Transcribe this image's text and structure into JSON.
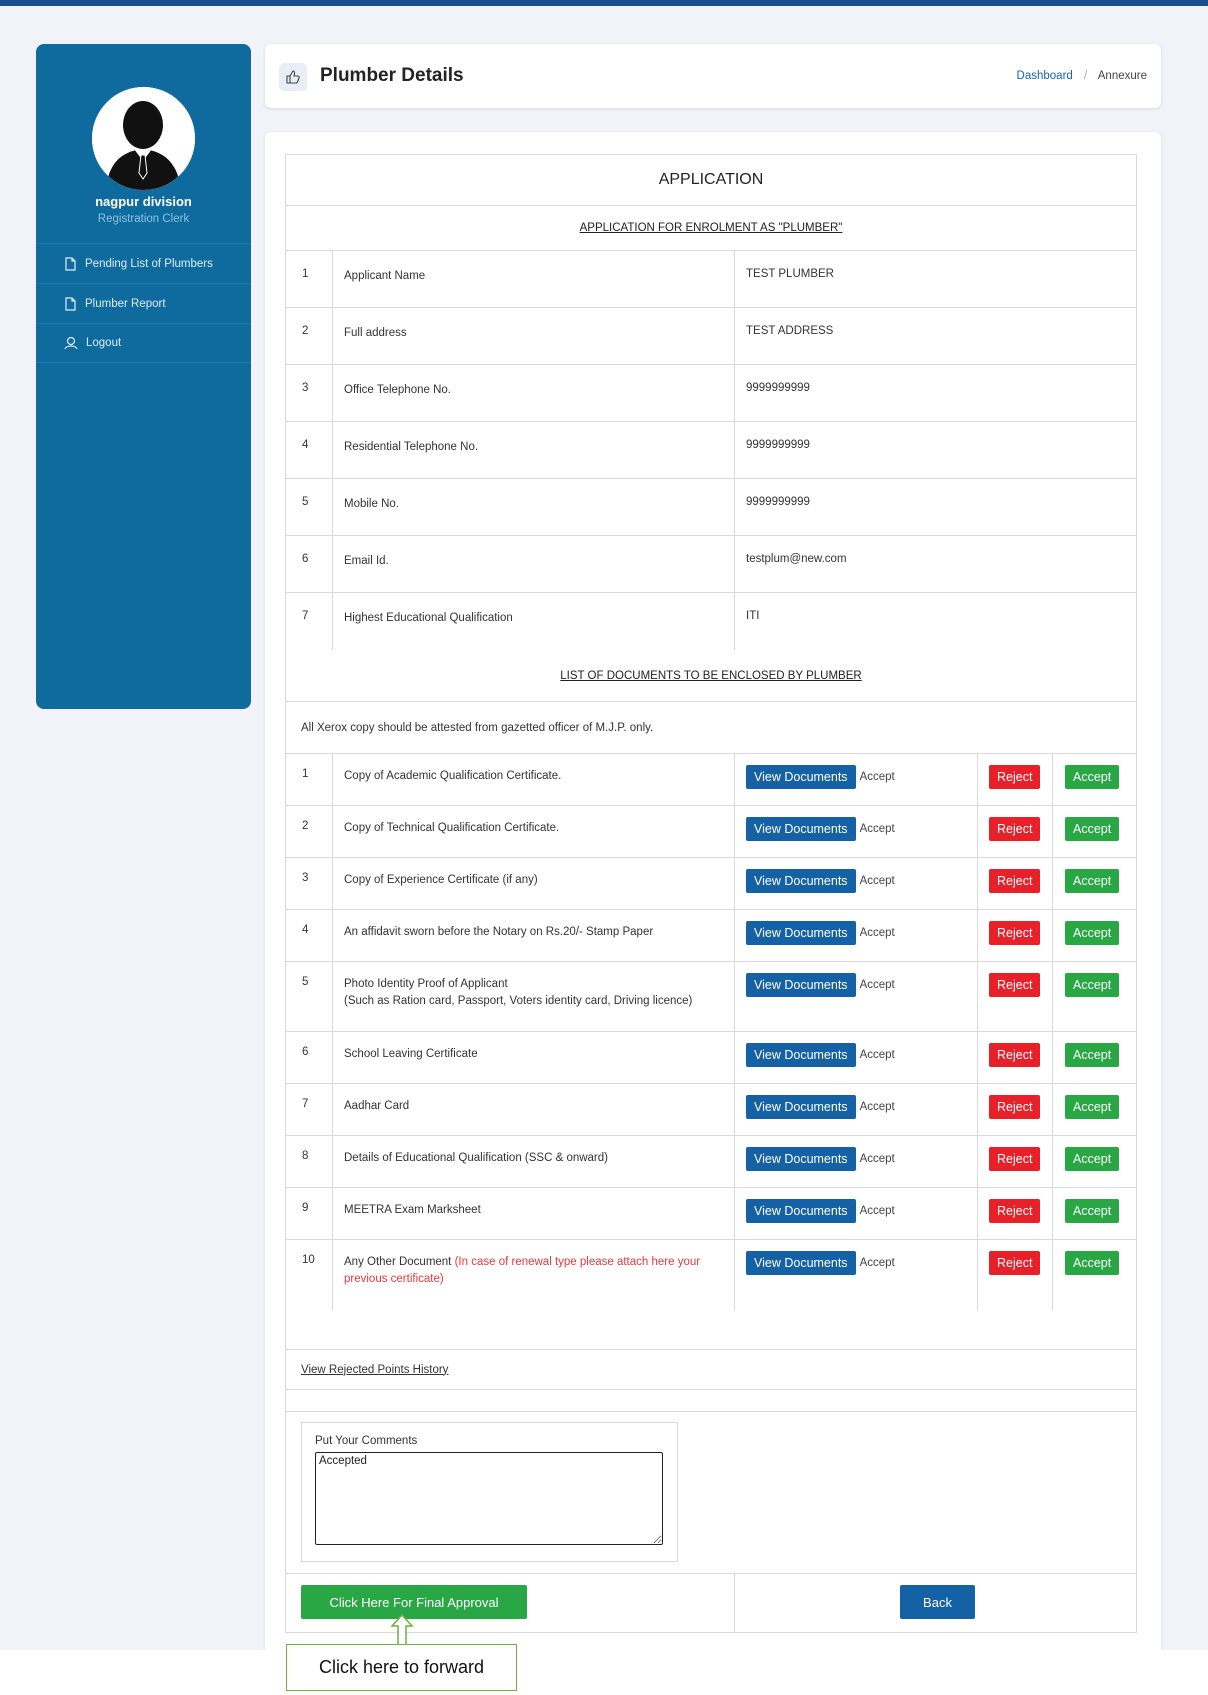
{
  "user": {
    "name": "nagpur division",
    "role": "Registration Clerk"
  },
  "sidebar": {
    "items": [
      {
        "label": "Pending List of Plumbers",
        "icon": "file-icon"
      },
      {
        "label": "Plumber Report",
        "icon": "file-icon"
      },
      {
        "label": "Logout",
        "icon": "user-icon"
      }
    ]
  },
  "header": {
    "title": "Plumber Details",
    "icon": "thumbs-up-icon"
  },
  "breadcrumb": {
    "link": "Dashboard",
    "separator": "/",
    "current": "Annexure"
  },
  "form": {
    "title": "APPLICATION",
    "subtitle": "APPLICATION FOR ENROLMENT AS \"PLUMBER\"",
    "fields": [
      {
        "no": "1",
        "label": "Applicant Name",
        "value": "TEST PLUMBER"
      },
      {
        "no": "2",
        "label": "Full address",
        "value": "TEST ADDRESS"
      },
      {
        "no": "3",
        "label": "Office Telephone No.",
        "value": "9999999999"
      },
      {
        "no": "4",
        "label": "Residential Telephone No.",
        "value": "9999999999"
      },
      {
        "no": "5",
        "label": "Mobile No.",
        "value": "9999999999"
      },
      {
        "no": "6",
        "label": "Email Id.",
        "value": "testplum@new.com"
      },
      {
        "no": "7",
        "label": "Highest Educational Qualification",
        "value": "ITI"
      }
    ],
    "docs_title": "LIST OF DOCUMENTS TO BE ENCLOSED BY PLUMBER",
    "docs_note": "All Xerox copy should be attested from gazetted officer of M.J.P. only.",
    "view_label": "View Documents",
    "status_label": "Accept",
    "reject_label": "Reject",
    "accept_label": "Accept",
    "documents": [
      {
        "no": "1",
        "label": "Copy of Academic Qualification Certificate."
      },
      {
        "no": "2",
        "label": "Copy of Technical Qualification Certificate."
      },
      {
        "no": "3",
        "label": "Copy of Experience Certificate (if any)"
      },
      {
        "no": "4",
        "label": "An affidavit sworn before the Notary on Rs.20/- Stamp Paper"
      },
      {
        "no": "5",
        "label": "Photo Identity Proof of Applicant",
        "label2": "(Such as Ration card, Passport, Voters identity card, Driving licence)"
      },
      {
        "no": "6",
        "label": "School Leaving Certificate"
      },
      {
        "no": "7",
        "label": "Aadhar Card"
      },
      {
        "no": "8",
        "label": "Details of Educational Qualification (SSC & onward)"
      },
      {
        "no": "9",
        "label": "MEETRA Exam Marksheet"
      },
      {
        "no": "10",
        "label": "Any Other Document",
        "note": "(In case of renewal type please attach here your previous certificate)"
      }
    ],
    "history_link": "View Rejected Points History",
    "comments_label": "Put Your Comments",
    "comments_value": "Accepted",
    "final_button": "Click Here For Final Approval",
    "back_button": "Back"
  },
  "callout": {
    "text": "Click here to forward"
  },
  "colors": {
    "sidebar": "#0f6b9e",
    "primary": "#1561a5",
    "danger": "#e8202a",
    "success": "#29a745"
  }
}
